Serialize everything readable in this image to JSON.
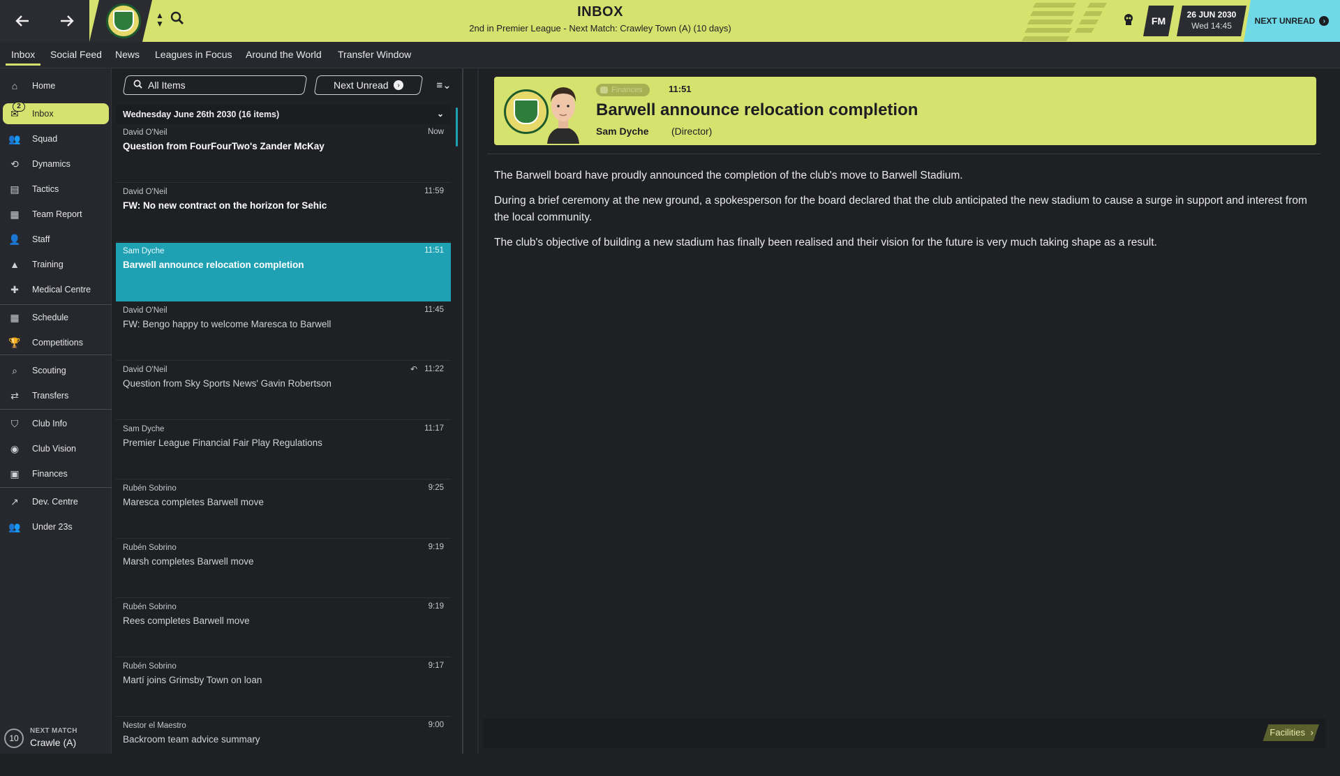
{
  "header": {
    "title": "INBOX",
    "subtitle": "2nd in Premier League - Next Match: Crawley Town (A) (10 days)",
    "fm_label": "FM",
    "date": "26 JUN 2030",
    "day_time": "Wed 14:45",
    "next_unread": "NEXT UNREAD"
  },
  "tabs": [
    {
      "label": "Inbox"
    },
    {
      "label": "Social Feed"
    },
    {
      "label": "News"
    },
    {
      "label": "Leagues in Focus"
    },
    {
      "label": "Around the World"
    },
    {
      "label": "Transfer Window"
    }
  ],
  "sidebar": {
    "items": [
      {
        "label": "Home",
        "icon": "home-icon"
      },
      {
        "label": "Inbox",
        "icon": "inbox-icon",
        "badge": "2"
      },
      {
        "label": "Squad",
        "icon": "squad-icon"
      },
      {
        "label": "Dynamics",
        "icon": "dynamics-icon"
      },
      {
        "label": "Tactics",
        "icon": "tactics-icon"
      },
      {
        "label": "Team Report",
        "icon": "report-icon"
      },
      {
        "label": "Staff",
        "icon": "staff-icon"
      },
      {
        "label": "Training",
        "icon": "training-icon"
      },
      {
        "label": "Medical Centre",
        "icon": "medical-icon"
      },
      {
        "label": "Schedule",
        "icon": "calendar-icon"
      },
      {
        "label": "Competitions",
        "icon": "trophy-icon"
      },
      {
        "label": "Scouting",
        "icon": "search-icon"
      },
      {
        "label": "Transfers",
        "icon": "transfer-icon"
      },
      {
        "label": "Club Info",
        "icon": "shield-icon"
      },
      {
        "label": "Club Vision",
        "icon": "vision-icon"
      },
      {
        "label": "Finances",
        "icon": "money-icon"
      },
      {
        "label": "Dev. Centre",
        "icon": "development-icon"
      },
      {
        "label": "Under 23s",
        "icon": "youth-icon"
      }
    ],
    "next_match_label": "NEXT MATCH",
    "next_match_value": "Crawle (A)",
    "next_match_days": "10"
  },
  "list": {
    "filter_all": "All Items",
    "filter_next": "Next Unread",
    "group_title": "Wednesday June 26th 2030 (16 items)",
    "messages": [
      {
        "sender": "David O'Neil",
        "time": "Now",
        "subject": "Question from FourFourTwo's Zander McKay",
        "unread": true
      },
      {
        "sender": "David O'Neil",
        "time": "11:59",
        "subject": "FW: No new contract on the horizon for Sehic",
        "unread": true
      },
      {
        "sender": "Sam Dyche",
        "time": "11:51",
        "subject": "Barwell announce relocation completion",
        "selected": true
      },
      {
        "sender": "David O'Neil",
        "time": "11:45",
        "subject": "FW: Bengo happy to welcome Maresca to Barwell"
      },
      {
        "sender": "David O'Neil",
        "time": "11:22",
        "subject": "Question from Sky Sports News' Gavin Robertson",
        "replied": true
      },
      {
        "sender": "Sam Dyche",
        "time": "11:17",
        "subject": "Premier League Financial Fair Play Regulations"
      },
      {
        "sender": "Rubén Sobrino",
        "time": "9:25",
        "subject": "Maresca completes Barwell move"
      },
      {
        "sender": "Rubén Sobrino",
        "time": "9:19",
        "subject": "Marsh completes Barwell move"
      },
      {
        "sender": "Rubén Sobrino",
        "time": "9:19",
        "subject": "Rees completes Barwell move"
      },
      {
        "sender": "Rubén Sobrino",
        "time": "9:17",
        "subject": "Martí joins Grimsby Town on loan"
      },
      {
        "sender": "Nestor el Maestro",
        "time": "9:00",
        "subject": "Backroom team advice summary"
      }
    ]
  },
  "message": {
    "category": "Finances",
    "time": "11:51",
    "title": "Barwell announce relocation completion",
    "from": "Sam Dyche",
    "role": "(Director)",
    "paragraphs": [
      "The Barwell board have proudly announced the completion of the club's move to Barwell Stadium.",
      "During a brief ceremony at the new ground, a spokesperson for the board declared that the club anticipated the new stadium to cause a surge in support and interest from the local community.",
      "The club's objective of building a new stadium has finally been realised and their vision for the future is very much taking shape as a result."
    ],
    "facilities_button": "Facilities"
  },
  "colors": {
    "accent": "#d6e26e",
    "selected": "#1fa1b3",
    "next_unread_bg": "#6fd9e8",
    "background": "#1e2024"
  }
}
